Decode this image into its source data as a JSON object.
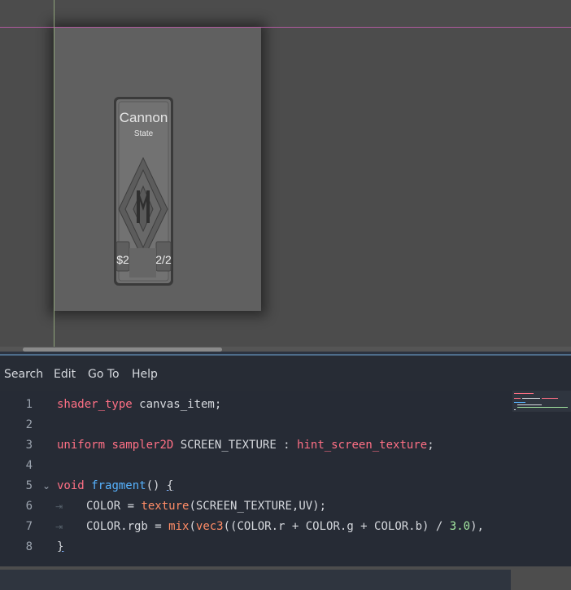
{
  "card": {
    "title": "Cannon",
    "subtitle": "State",
    "cost": "$2",
    "stats": "2/2"
  },
  "menu": {
    "items": [
      "Search",
      "Edit",
      "Go To",
      "Help"
    ]
  },
  "code": {
    "line_numbers": [
      "1",
      "2",
      "3",
      "4",
      "5",
      "6",
      "7",
      "8"
    ],
    "lines": [
      "shader_type canvas_item;",
      "",
      "uniform sampler2D SCREEN_TEXTURE : hint_screen_texture;",
      "",
      "void fragment() {",
      "    COLOR = texture(SCREEN_TEXTURE,UV);",
      "    COLOR.rgb = mix(vec3((COLOR.r + COLOR.g + COLOR.b) / 3.0),",
      "}"
    ],
    "tokens": {
      "l1_kw": "shader_type",
      "l1_rest": " canvas_item;",
      "l3_kw": "uniform",
      "l3_type": "sampler2D",
      "l3_mid": " SCREEN_TEXTURE : ",
      "l3_hint": "hint_screen_texture",
      "l3_end": ";",
      "l5_kw": "void",
      "l5_fn": "fragment",
      "l5_paren": "() ",
      "l5_brace": "{",
      "l6_a": "COLOR = ",
      "l6_bi": "texture",
      "l6_b": "(SCREEN_TEXTURE,UV);",
      "l7_a": "COLOR.rgb = ",
      "l7_mix": "mix",
      "l7_b": "(",
      "l7_vec": "vec3",
      "l7_c": "((COLOR.r + COLOR.g + COLOR.b) / ",
      "l7_num": "3.0",
      "l7_d": "),",
      "l8_brace": "}"
    }
  },
  "colors": {
    "keyword": "#ff7085",
    "function": "#57b3ff",
    "builtin": "#ff8c66",
    "number": "#a3e6a0",
    "editor_bg": "#262b35"
  }
}
